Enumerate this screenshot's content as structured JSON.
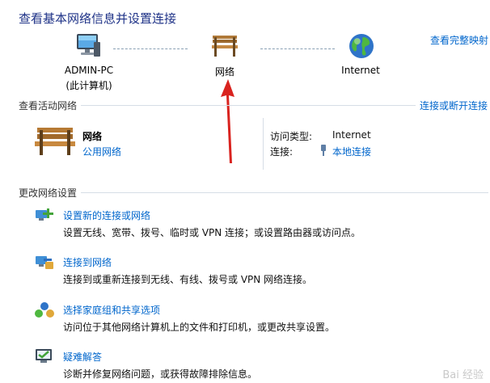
{
  "header": {
    "title": "查看基本网络信息并设置连接",
    "map_link": "查看完整映射"
  },
  "network_map": {
    "nodes": [
      {
        "label": "ADMIN-PC",
        "sublabel": "(此计算机)",
        "icon": "computer-icon"
      },
      {
        "label": "网络",
        "icon": "bench-icon"
      },
      {
        "label": "Internet",
        "icon": "globe-icon"
      }
    ]
  },
  "active_networks": {
    "header": "查看活动网络",
    "connect_link": "连接或断开连接",
    "network_name": "网络",
    "network_type_link": "公用网络",
    "access_type_label": "访问类型:",
    "access_type_value": "Internet",
    "connection_label": "连接:",
    "connection_value": "本地连接"
  },
  "change_settings": {
    "header": "更改网络设置",
    "tasks": [
      {
        "link": "设置新的连接或网络",
        "desc": "设置无线、宽带、拨号、临时或 VPN 连接；或设置路由器或访问点。",
        "icon": "new-connection-icon"
      },
      {
        "link": "连接到网络",
        "desc": "连接到或重新连接到无线、有线、拨号或 VPN 网络连接。",
        "icon": "connect-network-icon"
      },
      {
        "link": "选择家庭组和共享选项",
        "desc": "访问位于其他网络计算机上的文件和打印机，或更改共享设置。",
        "icon": "homegroup-icon"
      },
      {
        "link": "疑难解答",
        "desc": "诊断并修复网络问题，或获得故障排除信息。",
        "icon": "troubleshoot-icon"
      }
    ]
  },
  "watermark": "Bai 经验",
  "colors": {
    "link": "#0066cc",
    "title": "#1e3287",
    "arrow": "#d9231f"
  }
}
